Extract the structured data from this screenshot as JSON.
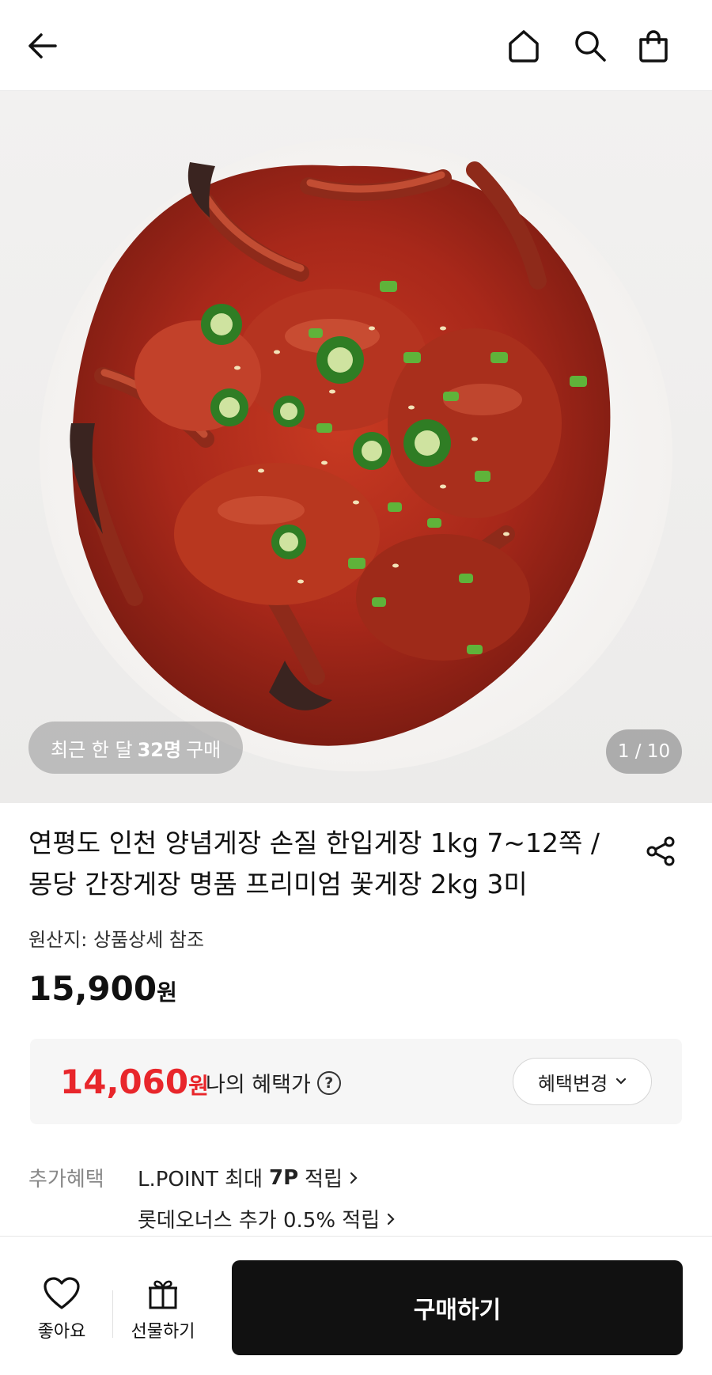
{
  "header": {
    "icons": [
      "back-arrow-icon",
      "home-icon",
      "search-icon",
      "shopping-bag-icon"
    ]
  },
  "hero": {
    "recent_prefix": "최근 한 달",
    "recent_count": "32명",
    "recent_suffix": "구매",
    "pager": "1 / 10"
  },
  "product": {
    "title": "연평도 인천 양념게장 손질 한입게장 1kg 7~12쪽 / 몽당 간장게장 명품 프리미엄 꽃게장 2kg 3미",
    "origin": "원산지: 상품상세 참조",
    "price": "15,900",
    "price_unit": "원"
  },
  "benefit": {
    "price": "14,060",
    "price_unit": "원",
    "label": "나의 혜택가",
    "help": "?",
    "change_label": "혜택변경",
    "accent_color": "#e8262b"
  },
  "extra": {
    "label": "추가혜택",
    "item1_prefix": "L.POINT 최대",
    "item1_bold": "7P",
    "item1_suffix": "적립",
    "item2": "롯데오너스 추가 0.5% 적립"
  },
  "bottom": {
    "like_label": "좋아요",
    "gift_label": "선물하기",
    "buy_label": "구매하기"
  }
}
